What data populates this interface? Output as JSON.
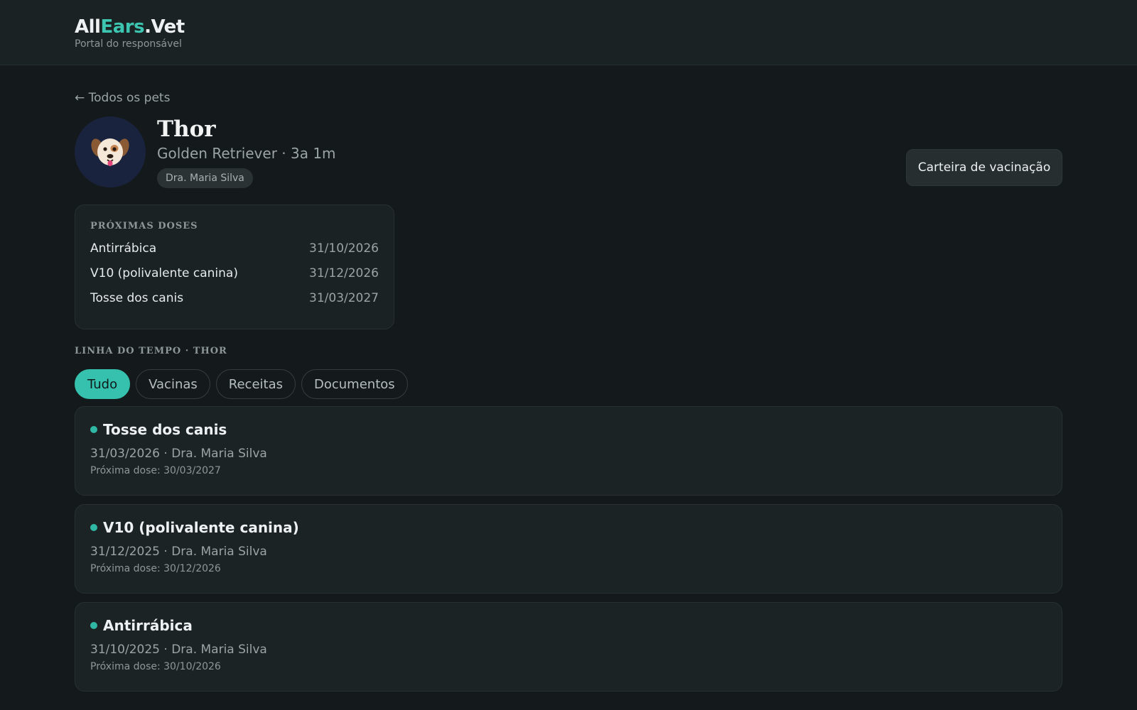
{
  "app": {
    "brand_part1": "All",
    "brand_part2": "Ears",
    "brand_part3": ".Vet",
    "tagline": "Portal do responsável",
    "accent_color": "#3cc6b1"
  },
  "nav": {
    "back_label": "← Todos os pets"
  },
  "pet": {
    "name": "Thor",
    "subtitle": "Golden Retriever · 3a 1m",
    "vet_tag": "Dra. Maria Silva",
    "avatar_icon": "dog-face-icon"
  },
  "actions": {
    "vaccination_card_label": "Carteira de vacinação"
  },
  "upcoming": {
    "title": "PRÓXIMAS DOSES",
    "items": [
      {
        "name": "Antirrábica",
        "date": "31/10/2026"
      },
      {
        "name": "V10 (polivalente canina)",
        "date": "31/12/2026"
      },
      {
        "name": "Tosse dos canis",
        "date": "31/03/2027"
      }
    ]
  },
  "timeline": {
    "title": "LINHA DO TEMPO · THOR",
    "tabs": [
      {
        "label": "Tudo",
        "active": true
      },
      {
        "label": "Vacinas",
        "active": false
      },
      {
        "label": "Receitas",
        "active": false
      },
      {
        "label": "Documentos",
        "active": false
      }
    ],
    "events": [
      {
        "title": "Tosse dos canis",
        "meta": "31/03/2026 · Dra. Maria Silva",
        "next": "Próxima dose: 30/03/2027"
      },
      {
        "title": "V10 (polivalente canina)",
        "meta": "31/12/2025 · Dra. Maria Silva",
        "next": "Próxima dose: 30/12/2026"
      },
      {
        "title": "Antirrábica",
        "meta": "31/10/2025 · Dra. Maria Silva",
        "next": "Próxima dose: 30/10/2026"
      }
    ]
  }
}
